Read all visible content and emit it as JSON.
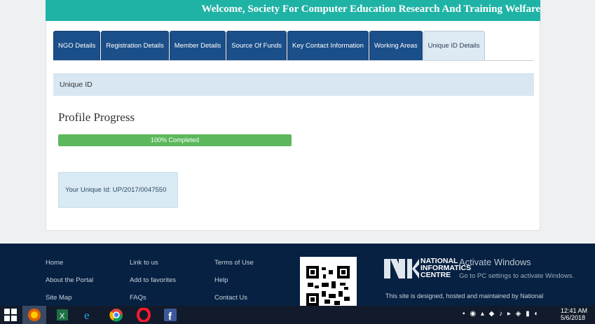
{
  "header": {
    "welcome": "Welcome, Society For Computer Education Research And Training Welfare"
  },
  "tabs": [
    {
      "label": "NGO Details",
      "active": false
    },
    {
      "label": "Registration Details",
      "active": false
    },
    {
      "label": "Member Details",
      "active": false
    },
    {
      "label": "Source Of Funds",
      "active": false
    },
    {
      "label": "Key Contact Information",
      "active": false
    },
    {
      "label": "Working Areas",
      "active": false
    },
    {
      "label": "Unique ID Details",
      "active": true
    }
  ],
  "section": {
    "header": "Unique ID",
    "profile_title": "Profile Progress",
    "progress": {
      "percent": 100,
      "label": "100% Completed"
    },
    "unique_id_text": "Your Unique Id: UP/2017/0047550"
  },
  "footer": {
    "col1": [
      "Home",
      "About the Portal",
      "Site Map"
    ],
    "col2": [
      "Link to us",
      "Add to favorites",
      "FAQs"
    ],
    "col3": [
      "Terms of Use",
      "Help",
      "Contact Us"
    ],
    "nic_name": [
      "NATIONAL",
      "INFORMATICS",
      "CENTRE"
    ],
    "activate_title": "Activate Windows",
    "activate_sub": "Go to PC settings to activate Windows.",
    "designed_text": "This site is designed, hosted and maintained by National"
  },
  "taskbar": {
    "clock_time": "12:41 AM",
    "clock_date": "5/6/2018"
  },
  "colors": {
    "teal": "#1fb3a5",
    "tab_blue": "#1b4f8a",
    "progress_green": "#5cb85c",
    "footer_navy": "#062142"
  }
}
